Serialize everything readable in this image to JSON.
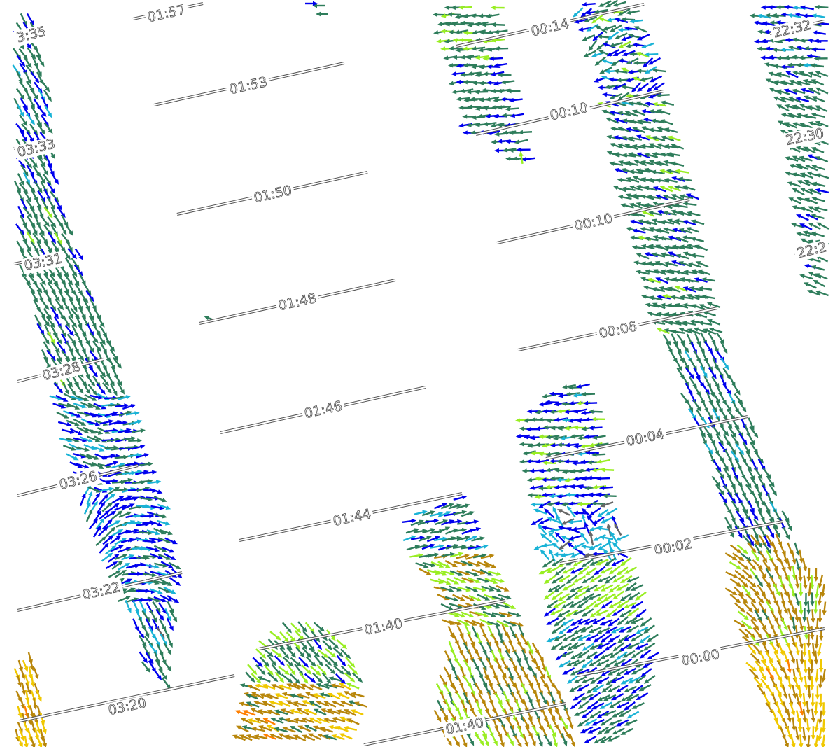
{
  "colors": {
    "background": "#ffffff",
    "track_line": "#555555",
    "label_stroke": "#555555",
    "arrow_palette": [
      "#2e7d5b",
      "#0000ee",
      "#1ab3d6",
      "#99ee22",
      "#b8860b",
      "#f0c800",
      "#ff7f00",
      "#666666"
    ]
  },
  "passes": [
    {
      "name": "left-swath",
      "ticks": [
        {
          "label": "3:35"
        },
        {
          "label": "03:33"
        },
        {
          "label": "03:31"
        },
        {
          "label": "03:28"
        },
        {
          "label": "03:26"
        },
        {
          "label": "03:22"
        },
        {
          "label": "03:20"
        }
      ]
    },
    {
      "name": "middle-swath",
      "ticks": [
        {
          "label": "01:57"
        },
        {
          "label": "01:53"
        },
        {
          "label": "01:50"
        },
        {
          "label": "01:48"
        },
        {
          "label": "01:46"
        },
        {
          "label": "01:44"
        },
        {
          "label": "01:40"
        },
        {
          "label": "01:40"
        }
      ]
    },
    {
      "name": "right-swath",
      "ticks": [
        {
          "label": "00:14"
        },
        {
          "label": "00:10"
        },
        {
          "label": "00:10"
        },
        {
          "label": "00:06"
        },
        {
          "label": "00:04"
        },
        {
          "label": "00:02"
        },
        {
          "label": "00:00"
        }
      ]
    },
    {
      "name": "far-right-swath",
      "ticks": [
        {
          "label": "22:32"
        },
        {
          "label": "22:30"
        },
        {
          "label": "22:2"
        }
      ]
    }
  ]
}
